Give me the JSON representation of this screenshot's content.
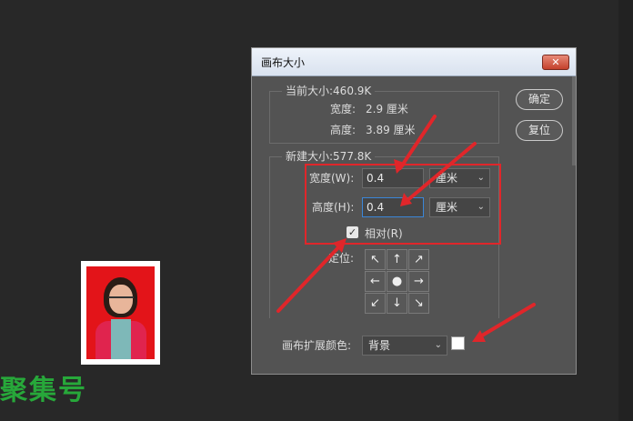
{
  "dialog": {
    "title": "画布大小",
    "close_label": "✕",
    "current_size": {
      "legend": "当前大小:460.9K",
      "width_label": "宽度:",
      "width_value": "2.9 厘米",
      "height_label": "高度:",
      "height_value": "3.89 厘米"
    },
    "new_size": {
      "legend": "新建大小:577.8K",
      "width_label": "宽度(W):",
      "width_value": "0.4",
      "width_unit": "厘米",
      "height_label": "高度(H):",
      "height_value": "0.4",
      "height_unit": "厘米",
      "relative_label": "相对(R)",
      "relative_checked": true,
      "anchor_label": "定位:",
      "anchor_cells": [
        "↖",
        "↑",
        "↗",
        "←",
        "●",
        "→",
        "↙",
        "↓",
        "↘"
      ]
    },
    "canvas_ext_color_label": "画布扩展颜色:",
    "canvas_ext_color_value": "背景",
    "swatch_color": "#ffffff",
    "ok_label": "确定",
    "reset_label": "复位"
  },
  "watermark": {
    "text": "聚集号"
  },
  "annotation_color": "#e0262a"
}
